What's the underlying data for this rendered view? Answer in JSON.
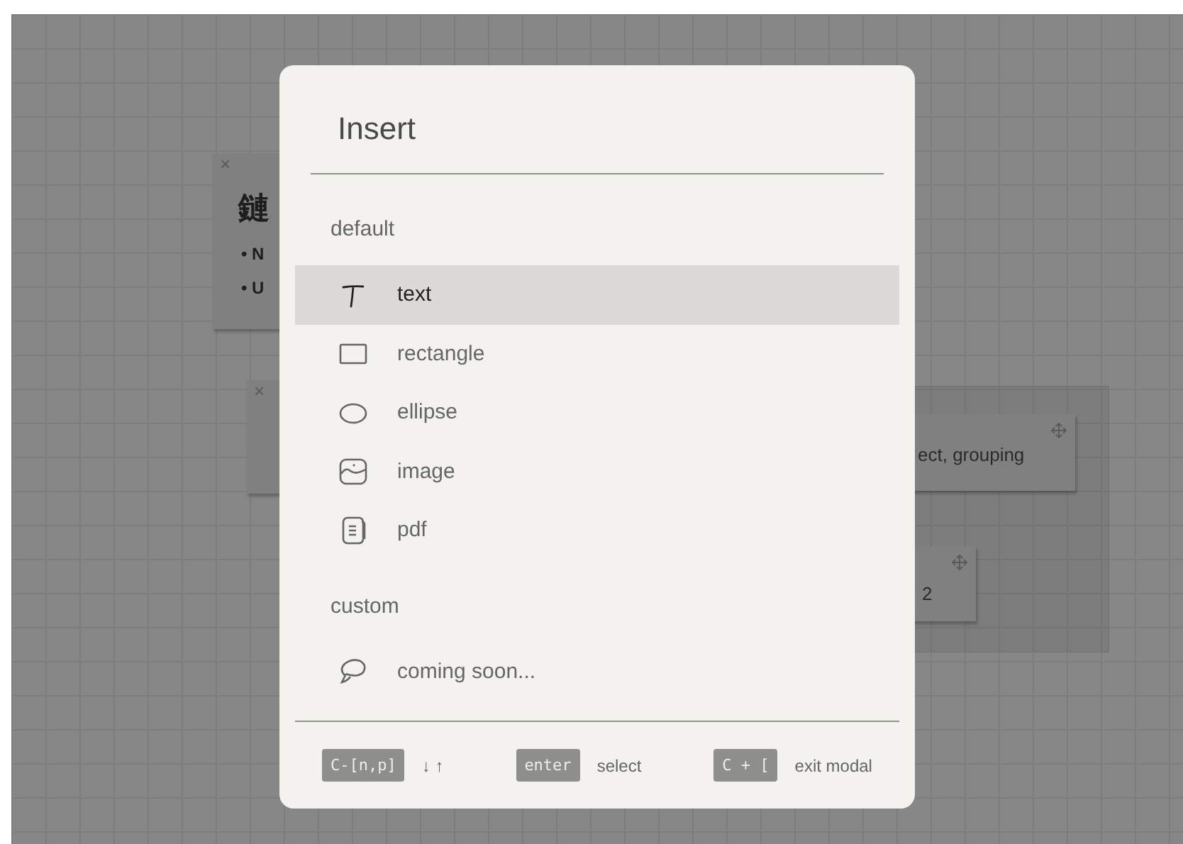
{
  "canvas": {
    "cards": [
      {
        "kind": "note",
        "close": "×",
        "title": "鏈",
        "bullets": [
          "• N",
          "• U"
        ]
      },
      {
        "kind": "empty",
        "close": "×"
      },
      {
        "kind": "grouped",
        "text": "ect, grouping"
      },
      {
        "kind": "grouped",
        "text": "2"
      }
    ]
  },
  "modal": {
    "title": "Insert",
    "sections": [
      {
        "heading": "default",
        "items": [
          {
            "kind": "text",
            "label": "text",
            "selected": true
          },
          {
            "kind": "rectangle",
            "label": "rectangle",
            "selected": false
          },
          {
            "kind": "ellipse",
            "label": "ellipse",
            "selected": false
          },
          {
            "kind": "image",
            "label": "image",
            "selected": false
          },
          {
            "kind": "pdf",
            "label": "pdf",
            "selected": false
          }
        ]
      },
      {
        "heading": "custom",
        "items": [
          {
            "kind": "custom",
            "label": "coming soon...",
            "selected": false
          }
        ]
      }
    ],
    "hints": [
      {
        "key": "C-[n,p]",
        "action": "↓ ↑"
      },
      {
        "key": "enter",
        "action": "select"
      },
      {
        "key": "C + [",
        "action": "exit modal"
      }
    ]
  }
}
